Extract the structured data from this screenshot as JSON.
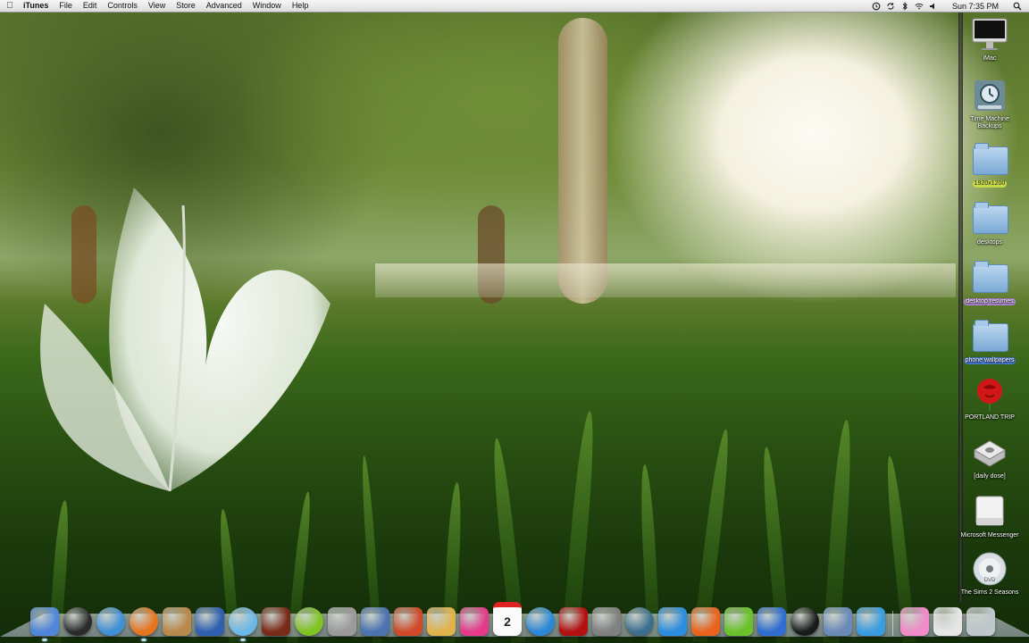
{
  "menubar": {
    "app_name": "iTunes",
    "items": [
      "File",
      "Edit",
      "Controls",
      "View",
      "Store",
      "Advanced",
      "Window",
      "Help"
    ],
    "clock": "Sun 7:35 PM",
    "status_icons": [
      "time-machine-icon",
      "sync-icon",
      "bluetooth-icon",
      "wifi-icon",
      "volume-icon",
      "spotlight-icon"
    ]
  },
  "desktop": {
    "icons": [
      {
        "label": "iMac",
        "icon": "imac-icon"
      },
      {
        "label": "Time Machine\nBackups",
        "icon": "time-machine-drive-icon"
      },
      {
        "label": "1920x1200",
        "icon": "folder-icon"
      },
      {
        "label": "desktops",
        "icon": "folder-icon"
      },
      {
        "label": "desktop resumes",
        "icon": "folder-icon"
      },
      {
        "label": "phone wallpapers",
        "icon": "folder-icon"
      },
      {
        "label": "PORTLAND TRIP",
        "icon": "rose-icon"
      },
      {
        "label": "[daily dose]",
        "icon": "disk-icon"
      },
      {
        "label": "Microsoft Messenger",
        "icon": "drive-icon"
      },
      {
        "label": "The Sims 2 Seasons",
        "icon": "dvd-icon"
      }
    ]
  },
  "dock": {
    "apps": [
      {
        "icon": "finder-icon",
        "color": "#4f86d9",
        "running": true
      },
      {
        "icon": "dashboard-icon",
        "color": "#2b2b2b",
        "running": false
      },
      {
        "icon": "safari-icon",
        "color": "#3f8fd6",
        "running": false
      },
      {
        "icon": "firefox-icon",
        "color": "#e8741c",
        "running": true
      },
      {
        "icon": "address-book-icon",
        "color": "#b8894a",
        "running": false
      },
      {
        "icon": "automator-icon",
        "color": "#2f5fb0",
        "running": false
      },
      {
        "icon": "itunes-icon",
        "color": "#6bb8e8",
        "running": true
      },
      {
        "icon": "photo-booth-icon",
        "color": "#7a2a18",
        "running": false
      },
      {
        "icon": "lime-icon",
        "color": "#7fc41f",
        "running": false
      },
      {
        "icon": "calculator-icon",
        "color": "#9a9a9a",
        "running": false
      },
      {
        "icon": "preview-icon",
        "color": "#4c73b0",
        "running": false
      },
      {
        "icon": "app-rainbow-icon",
        "color": "#d04a2a",
        "running": false
      },
      {
        "icon": "pencil-icon",
        "color": "#e0b34a",
        "running": false
      },
      {
        "icon": "heart-icon",
        "color": "#e43a8a",
        "running": false
      },
      {
        "icon": "ical-icon",
        "color": "#f0f0f0",
        "running": false
      },
      {
        "icon": "quicktime-icon",
        "color": "#2a88d8",
        "running": false
      },
      {
        "icon": "photo-red-icon",
        "color": "#b31010",
        "running": false
      },
      {
        "icon": "system-preferences-icon",
        "color": "#808080",
        "running": false
      },
      {
        "icon": "time-machine-icon",
        "color": "#3b6e8e",
        "running": false
      },
      {
        "icon": "w-app-icon",
        "color": "#2b8de0",
        "running": false
      },
      {
        "icon": "p-app-icon",
        "color": "#e8641c",
        "running": false
      },
      {
        "icon": "vine-icon",
        "color": "#6ac22a",
        "running": false
      },
      {
        "icon": "bluetooth-icon",
        "color": "#2f6ed0",
        "running": false
      },
      {
        "icon": "penguin-icon",
        "color": "#1a1a1a",
        "running": false
      },
      {
        "icon": "iphoto-icon",
        "color": "#6a8ab8",
        "running": false
      },
      {
        "icon": "messenger-icon",
        "color": "#3a9ce0",
        "running": false
      }
    ],
    "calendar_day": "2",
    "extras": [
      {
        "icon": "gloss-avatar-icon",
        "color": "#f08ac8"
      },
      {
        "icon": "jpeg-document-icon",
        "color": "#e6e6e6"
      },
      {
        "icon": "trash-icon",
        "color": "#bfc6cc"
      }
    ]
  }
}
